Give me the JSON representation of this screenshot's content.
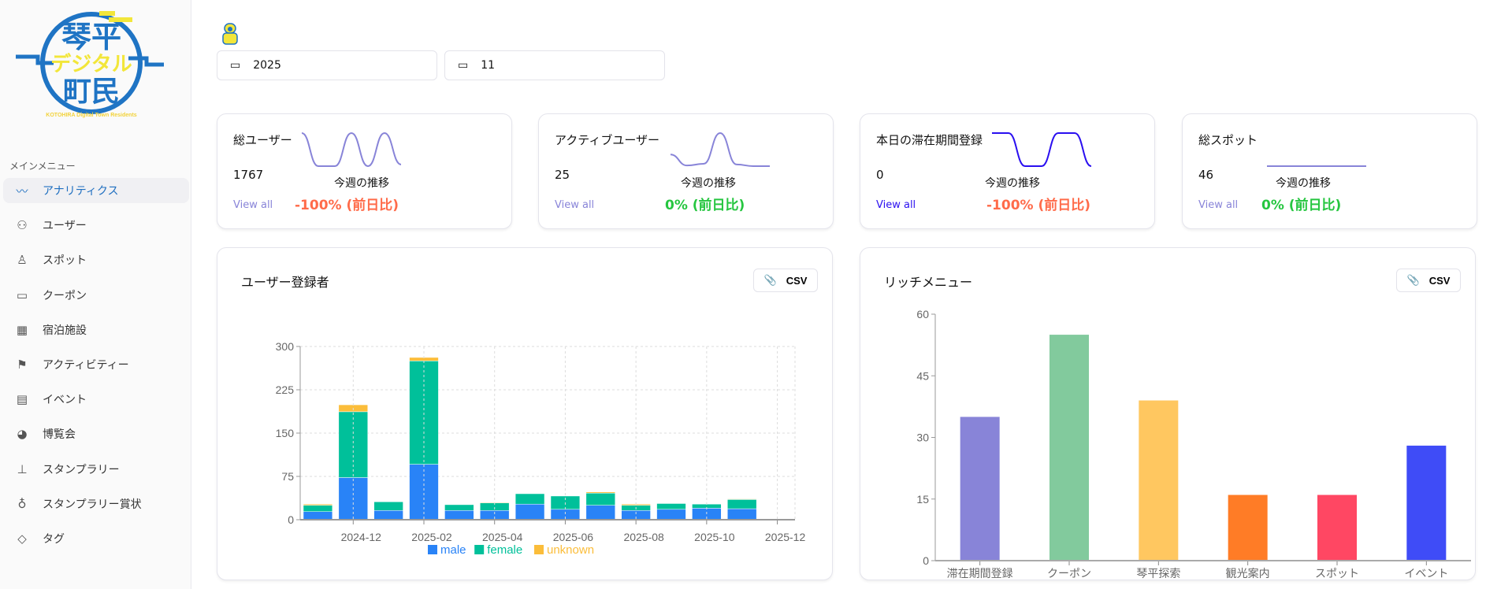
{
  "logo": {
    "text_main": "琴平",
    "text_sub": "デジタル",
    "text_bottom": "町民",
    "tagline": "KOTOHIRA Digital Town Residents"
  },
  "sidebar": {
    "section_title": "メインメニュー",
    "items": [
      {
        "label": "アナリティクス",
        "icon": "chart-line-icon",
        "glyph": "〰",
        "active": true
      },
      {
        "label": "ユーザー",
        "icon": "users-icon",
        "glyph": "⚇"
      },
      {
        "label": "スポット",
        "icon": "map-pin-user-icon",
        "glyph": "♙"
      },
      {
        "label": "クーポン",
        "icon": "ticket-icon",
        "glyph": "▭"
      },
      {
        "label": "宿泊施設",
        "icon": "building-icon",
        "glyph": "▦"
      },
      {
        "label": "アクティビティー",
        "icon": "flag-icon",
        "glyph": "⚑"
      },
      {
        "label": "イベント",
        "icon": "calendar-icon",
        "glyph": "▤"
      },
      {
        "label": "博覧会",
        "icon": "expo-icon",
        "glyph": "◕"
      },
      {
        "label": "スタンプラリー",
        "icon": "stamp-icon",
        "glyph": "⊥"
      },
      {
        "label": "スタンプラリー賞状",
        "icon": "award-icon",
        "glyph": "♁"
      },
      {
        "label": "タグ",
        "icon": "tag-icon",
        "glyph": "◇"
      }
    ]
  },
  "filters": {
    "year": "2025",
    "month": "11"
  },
  "kpis": [
    {
      "title": "総ユーザー",
      "value": "1767",
      "week_label": "今週の推移",
      "change": "-100% (前日比)",
      "change_type": "down",
      "view_all": "View all",
      "color": "#8884d8",
      "trend": [
        1,
        0,
        0,
        1,
        0,
        1,
        0.05
      ]
    },
    {
      "title": "アクティブユーザー",
      "value": "25",
      "week_label": "今週の推移",
      "change": "0% (前日比)",
      "change_type": "up",
      "view_all": "View all",
      "color": "#8884d8",
      "trend": [
        0.35,
        0.02,
        0.07,
        1,
        0.05,
        0,
        0
      ]
    },
    {
      "title": "本日の滞在期間登録",
      "value": "0",
      "week_label": "今週の推移",
      "change": "-100% (前日比)",
      "change_type": "down",
      "view_all": "View all",
      "color": "#2a0ff0",
      "trend": [
        1,
        1,
        0,
        0,
        1,
        1,
        0
      ]
    },
    {
      "title": "総スポット",
      "value": "46",
      "week_label": "今週の推移",
      "change": "0% (前日比)",
      "change_type": "up",
      "view_all": "View all",
      "color": "#8884d8",
      "trend": [
        0,
        0,
        0,
        0,
        0,
        0,
        0
      ]
    }
  ],
  "csv_label": "CSV",
  "chart_data": [
    {
      "type": "bar",
      "stacked": true,
      "title": "ユーザー登録者",
      "ylim": [
        0,
        300
      ],
      "yticks": [
        0,
        75,
        150,
        225,
        300
      ],
      "categories": [
        "2024-11",
        "2024-12",
        "2025-01",
        "2025-02",
        "2025-03",
        "2025-04",
        "2025-05",
        "2025-06",
        "2025-07",
        "2025-08",
        "2025-09",
        "2025-10",
        "2025-11",
        "2025-12"
      ],
      "xtick_labels": [
        "2024-12",
        "2025-02",
        "2025-04",
        "2025-06",
        "2025-08",
        "2025-10",
        "2025-12"
      ],
      "grid": true,
      "legend": "bottom",
      "series": [
        {
          "name": "male",
          "color": "#2983f7",
          "values": [
            14,
            73,
            16,
            96,
            16,
            16,
            27,
            18,
            25,
            16,
            18,
            20,
            19,
            0
          ]
        },
        {
          "name": "female",
          "color": "#00c09a",
          "values": [
            11,
            114,
            15,
            179,
            10,
            13,
            18,
            23,
            21,
            9,
            10,
            7,
            16,
            0
          ]
        },
        {
          "name": "unknown",
          "color": "#fbbd3a",
          "values": [
            2,
            12,
            0,
            6,
            0,
            1,
            0,
            0,
            2,
            2,
            0,
            0,
            1,
            0
          ]
        }
      ]
    },
    {
      "type": "bar",
      "title": "リッチメニュー",
      "ylim": [
        0,
        60
      ],
      "yticks": [
        0,
        15,
        30,
        45,
        60
      ],
      "grid": false,
      "categories": [
        "滞在期間登録",
        "クーポン",
        "琴平探索",
        "観光案内",
        "スポット",
        "イベント"
      ],
      "values": [
        35,
        55,
        39,
        16,
        16,
        28
      ],
      "colors": [
        "#8884d8",
        "#82ca9d",
        "#ffc760",
        "#ff7c26",
        "#ff4763",
        "#3f4cf7"
      ]
    }
  ]
}
